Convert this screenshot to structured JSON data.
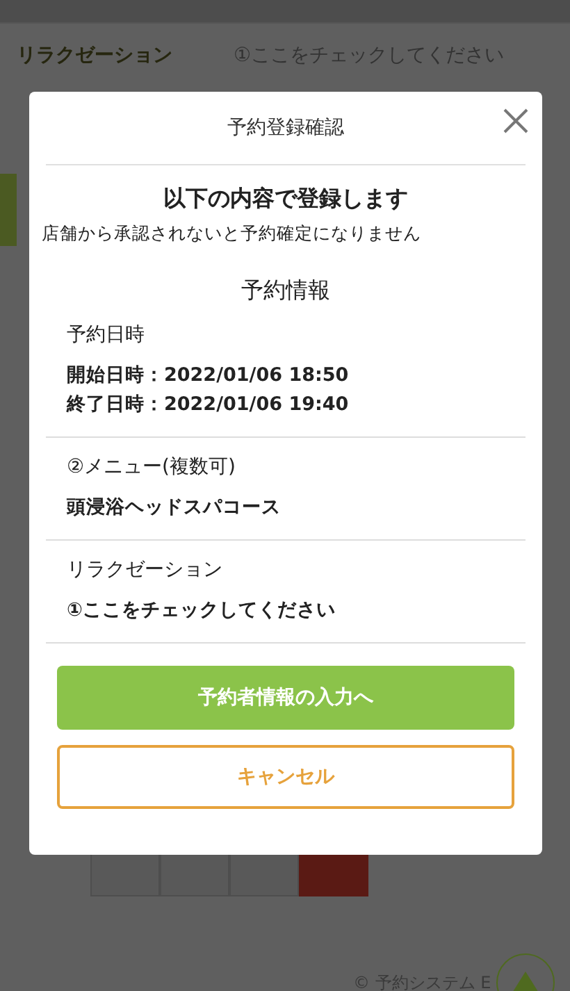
{
  "background": {
    "row": {
      "label": "リラクゼーション",
      "value": "①ここをチェックしてください"
    },
    "footer": "© 予約システム E"
  },
  "modal": {
    "title": "予約登録確認",
    "heading": "以下の内容で登録します",
    "notice": "店舗から承認されないと予約確定になりません",
    "section_title": "予約情報",
    "sections": [
      {
        "label": "予約日時",
        "lines": [
          "開始日時：2022/01/06 18:50",
          "終了日時：2022/01/06 19:40"
        ]
      },
      {
        "label": "②メニュー(複数可)",
        "lines": [
          "頭浸浴ヘッドスパコース"
        ]
      },
      {
        "label": "リラクゼーション",
        "lines": [
          "①ここをチェックしてください"
        ]
      }
    ],
    "buttons": [
      {
        "label": "予約者情報の入力へ",
        "kind": "primary"
      },
      {
        "label": "キャンセル",
        "kind": "outline"
      }
    ]
  }
}
